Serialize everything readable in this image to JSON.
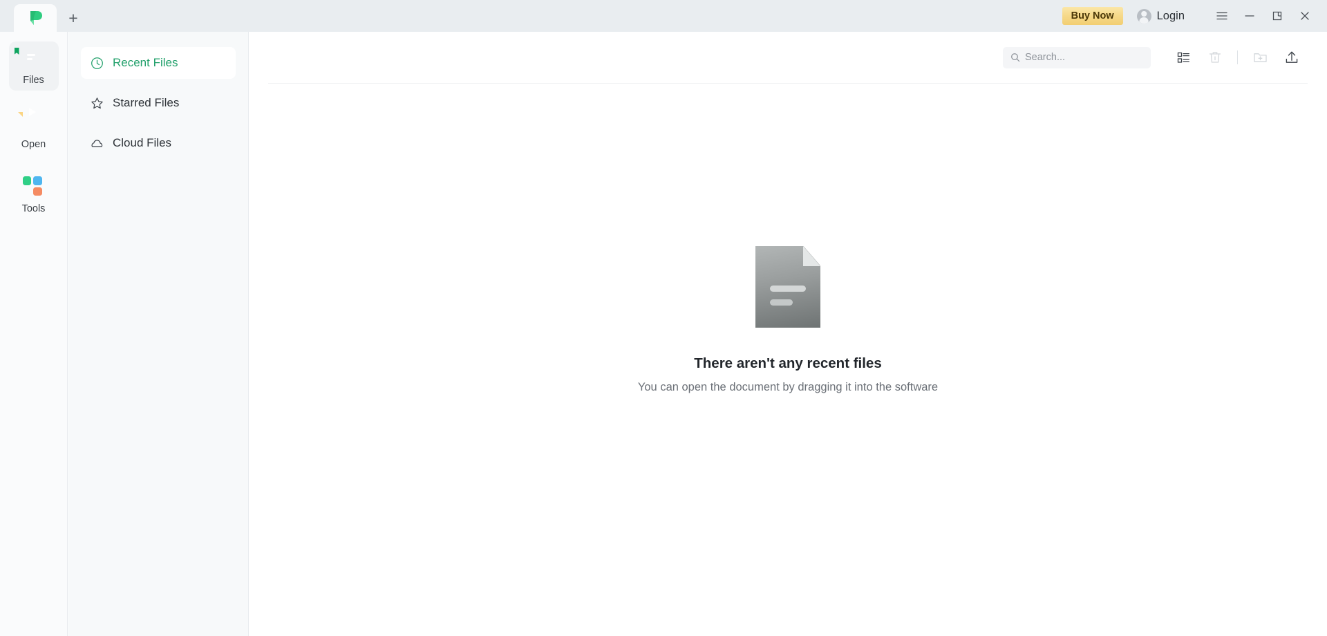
{
  "titlebar": {
    "app_logo_icon": "pdf-app-logo",
    "new_tab_icon": "plus-icon",
    "new_tab_label": "+",
    "buy_now_label": "Buy Now",
    "login_label": "Login",
    "avatar_icon": "user-avatar-icon",
    "menu_icon": "hamburger-menu-icon",
    "minimize_icon": "minimize-icon",
    "restore_icon": "restore-window-icon",
    "close_icon": "close-icon"
  },
  "rail": {
    "items": [
      {
        "label": "Files",
        "icon": "files-icon",
        "active": true
      },
      {
        "label": "Open",
        "icon": "open-icon",
        "active": false
      },
      {
        "label": "Tools",
        "icon": "tools-grid-icon",
        "active": false
      }
    ]
  },
  "nav": {
    "items": [
      {
        "label": "Recent Files",
        "icon": "clock-icon",
        "active": true
      },
      {
        "label": "Starred Files",
        "icon": "star-icon",
        "active": false
      },
      {
        "label": "Cloud Files",
        "icon": "cloud-icon",
        "active": false
      }
    ]
  },
  "toolbar": {
    "search_placeholder": "Search...",
    "search_value": "",
    "search_icon": "search-icon",
    "list_view_icon": "list-view-icon",
    "delete_icon": "trash-icon",
    "new_folder_icon": "new-folder-icon",
    "upload_icon": "upload-icon"
  },
  "empty_state": {
    "illustration_icon": "document-placeholder-icon",
    "title": "There aren't any recent files",
    "subtitle": "You can open the document by dragging it into the software"
  },
  "colors": {
    "brand_green": "#22a06b",
    "buy_now_gold": "#f6d98a",
    "titlebar_bg": "#e9edf0",
    "nav_bg": "#f7f9fa",
    "content_bg": "#ffffff"
  }
}
